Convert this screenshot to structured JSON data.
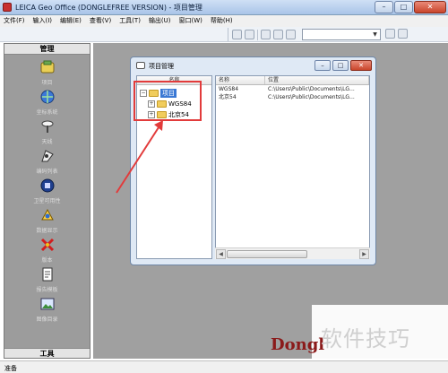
{
  "app": {
    "title": "LEICA Geo Office (DONGLEFREE VERSION) - 项目管理"
  },
  "window_controls": {
    "minimize": "–",
    "maximize": "□",
    "close": "✕"
  },
  "menu": [
    "文件(F)",
    "输入(I)",
    "编辑(E)",
    "查看(V)",
    "工具(T)",
    "输出(U)",
    "窗口(W)",
    "帮助(H)"
  ],
  "sidebar": {
    "header": "管理",
    "items": [
      {
        "label": "项目",
        "icon": "project-icon"
      },
      {
        "label": "坐标系统",
        "icon": "coordinate-system-icon"
      },
      {
        "label": "天线",
        "icon": "antenna-icon"
      },
      {
        "label": "编码列表",
        "icon": "codelist-icon"
      },
      {
        "label": "卫星可用性",
        "icon": "satellite-icon"
      },
      {
        "label": "数据显示",
        "icon": "data-display-icon"
      },
      {
        "label": "版本",
        "icon": "version-icon"
      },
      {
        "label": "报告模板",
        "icon": "report-template-icon"
      },
      {
        "label": "图像目录",
        "icon": "image-directory-icon"
      }
    ],
    "footer": "工具"
  },
  "child_window": {
    "title": "项目管理",
    "tree_header": "名称",
    "tree": {
      "root": "项目",
      "children": [
        "WGS84",
        "北京54"
      ]
    },
    "list_columns": [
      "名称",
      "位置"
    ],
    "list_rows": [
      {
        "name": "WGS84",
        "location": "C:\\Users\\Public\\Documents\\LG..."
      },
      {
        "name": "北京54",
        "location": "C:\\Users\\Public\\Documents\\LG..."
      }
    ]
  },
  "status": {
    "text": "准备"
  },
  "watermark": {
    "brand": "Dongl",
    "text": "软件技巧"
  },
  "colors": {
    "annotation": "#e23b3b",
    "workspace": "#a0a0a0",
    "selection": "#3a78d4"
  }
}
